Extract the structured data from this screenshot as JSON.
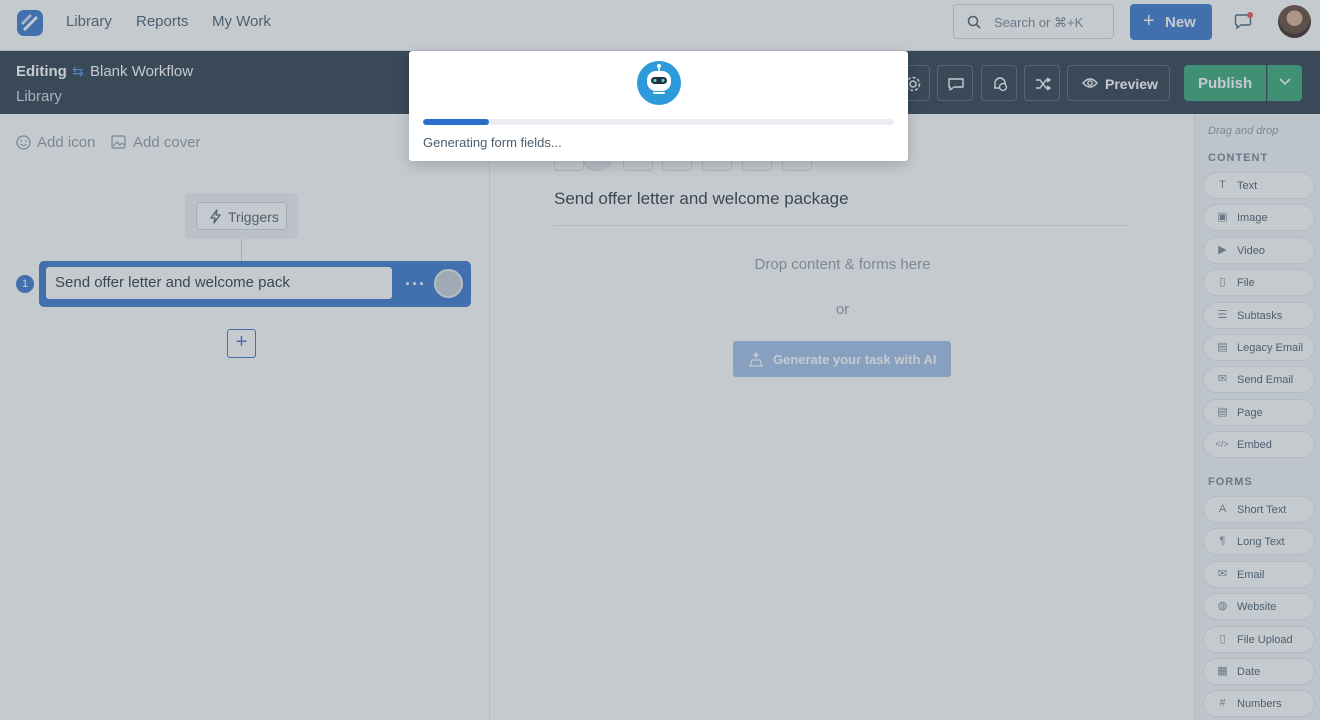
{
  "topnav": {
    "links": [
      "Library",
      "Reports",
      "My Work"
    ],
    "search_placeholder": "Search or ⌘+K",
    "new_label": "New",
    "accent": "#2c6ecb"
  },
  "editor": {
    "mode_label": "Editing",
    "workflow_name": "Blank Workflow",
    "breadcrumb": "Library",
    "preview_label": "Preview",
    "publish_label": "Publish",
    "publish_color": "#28a26e",
    "header_bg": "#1f2f3f"
  },
  "left": {
    "add_icon_label": "Add icon",
    "add_cover_label": "Add cover",
    "triggers_label": "Triggers",
    "tasks": [
      {
        "number": "1",
        "title": "Send offer letter and welcome pack"
      }
    ]
  },
  "content": {
    "task_title": "Send offer letter and welcome package",
    "drop_hint": "Drop content & forms here",
    "or_label": "or",
    "generate_label": "Generate your task with AI"
  },
  "sidebar": {
    "hint": "Drag and drop",
    "content_heading": "CONTENT",
    "content_items": [
      {
        "label": "Text",
        "icon": "text-icon"
      },
      {
        "label": "Image",
        "icon": "image-icon"
      },
      {
        "label": "Video",
        "icon": "video-icon"
      },
      {
        "label": "File",
        "icon": "file-icon"
      },
      {
        "label": "Subtasks",
        "icon": "list-icon"
      },
      {
        "label": "Legacy Email",
        "icon": "legacy-email-icon"
      },
      {
        "label": "Send Email",
        "icon": "email-icon"
      },
      {
        "label": "Page",
        "icon": "page-icon"
      },
      {
        "label": "Embed",
        "icon": "code-icon"
      }
    ],
    "forms_heading": "FORMS",
    "form_items": [
      {
        "label": "Short Text",
        "icon": "short-text-icon"
      },
      {
        "label": "Long Text",
        "icon": "paragraph-icon"
      },
      {
        "label": "Email",
        "icon": "email-icon"
      },
      {
        "label": "Website",
        "icon": "globe-icon"
      },
      {
        "label": "File Upload",
        "icon": "file-icon"
      },
      {
        "label": "Date",
        "icon": "calendar-icon"
      },
      {
        "label": "Numbers",
        "icon": "numbers-icon"
      }
    ]
  },
  "modal": {
    "status_text": "Generating form fields...",
    "progress_fraction": 0.14
  }
}
